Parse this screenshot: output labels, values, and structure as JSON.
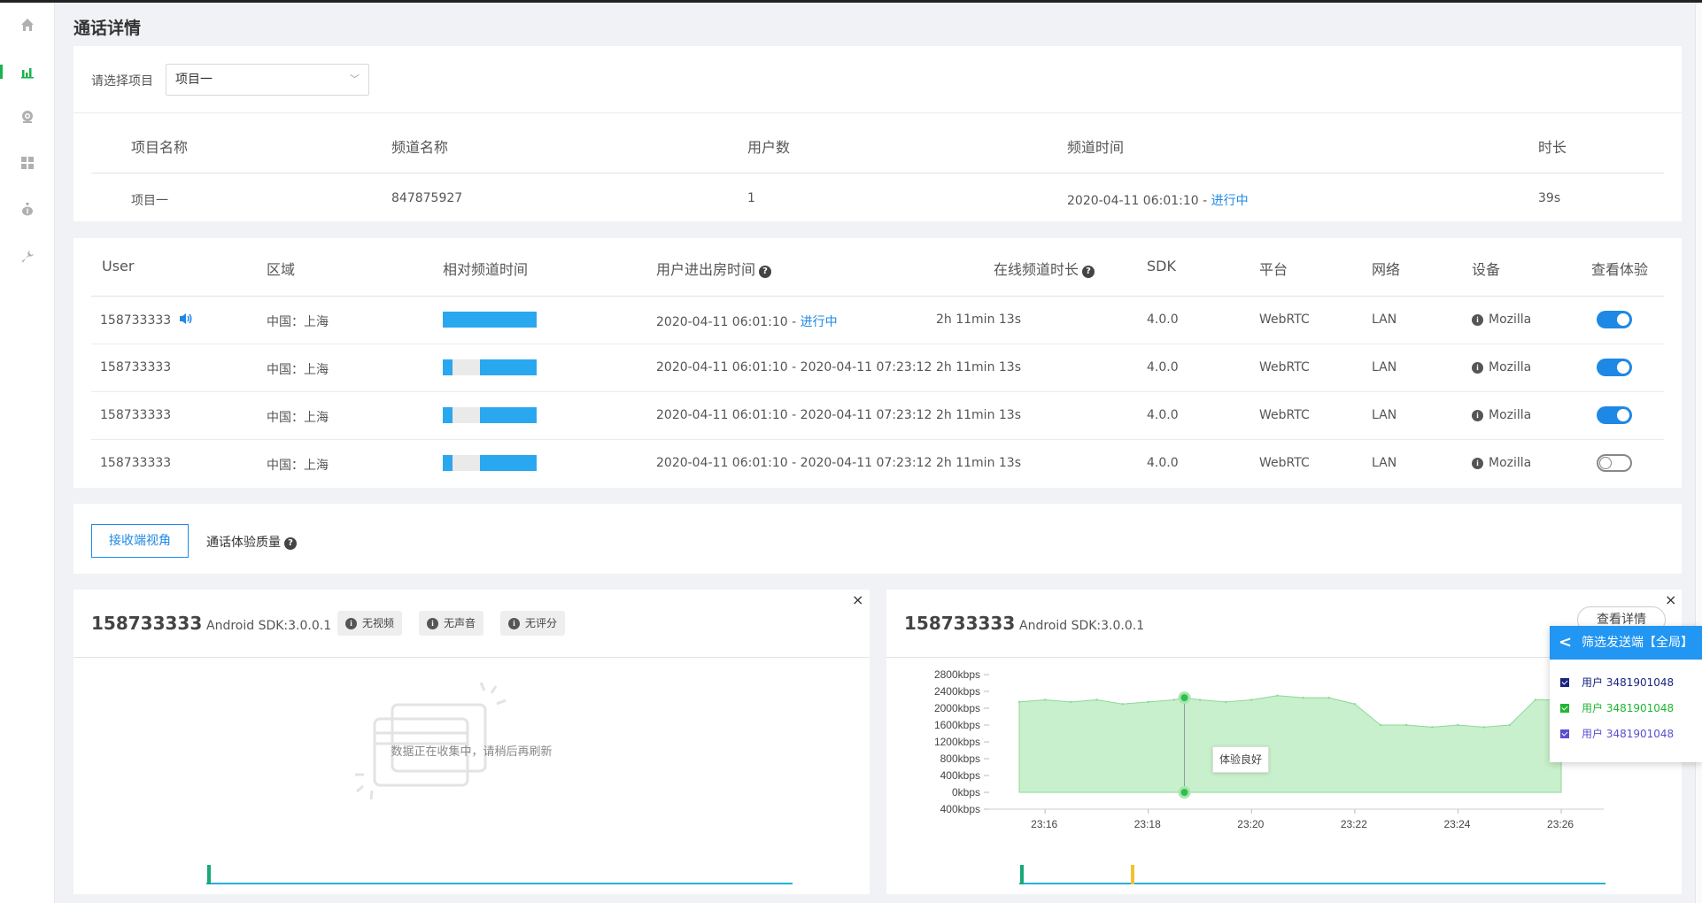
{
  "page": {
    "title": "通话详情"
  },
  "sidebar": {
    "items": [
      {
        "icon": "home-icon"
      },
      {
        "icon": "bar-chart-icon"
      },
      {
        "icon": "camera-icon"
      },
      {
        "icon": "grid-icon"
      },
      {
        "icon": "money-bag-icon"
      },
      {
        "icon": "wrench-icon"
      }
    ],
    "active_color": "#19b24b"
  },
  "project_select": {
    "label": "请选择项目",
    "value": "项目一"
  },
  "summary": {
    "headers": [
      "项目名称",
      "频道名称",
      "用户数",
      "频道时间",
      "时长"
    ],
    "row": {
      "project": "项目一",
      "channel": "847875927",
      "users": "1",
      "time": "2020-04-11 06:01:10",
      "time_sep": " - ",
      "status": "进行中",
      "duration": "39s"
    }
  },
  "users_table": {
    "headers": [
      "User",
      "区域",
      "相对频道时间",
      "用户进出房时间",
      "在线频道时长",
      "SDK",
      "平台",
      "网络",
      "设备",
      "查看体验"
    ],
    "rows": [
      {
        "user": "158733333",
        "region": "中国：上海",
        "bar": [
          [
            0,
            1
          ]
        ],
        "in": "2020-04-11 06:01:10",
        "sep": " - ",
        "out": "",
        "status": "进行中",
        "online": "2h 11min 13s",
        "sdk": "4.0.0",
        "platform": "WebRTC",
        "network": "LAN",
        "device": "Mozilla",
        "toggle": true,
        "speaking": true
      },
      {
        "user": "158733333",
        "region": "中国：上海",
        "bar": [
          [
            0,
            0.1
          ],
          [
            0.4,
            1
          ]
        ],
        "in": "2020-04-11 06:01:10",
        "sep": " - ",
        "out": "2020-04-11 07:23:12",
        "status": "",
        "online": "2h 11min 13s",
        "sdk": "4.0.0",
        "platform": "WebRTC",
        "network": "LAN",
        "device": "Mozilla",
        "toggle": true,
        "speaking": false
      },
      {
        "user": "158733333",
        "region": "中国：上海",
        "bar": [
          [
            0,
            0.1
          ],
          [
            0.4,
            1
          ]
        ],
        "in": "2020-04-11 06:01:10",
        "sep": " - ",
        "out": "2020-04-11 07:23:12",
        "status": "",
        "online": "2h 11min 13s",
        "sdk": "4.0.0",
        "platform": "WebRTC",
        "network": "LAN",
        "device": "Mozilla",
        "toggle": true,
        "speaking": false
      },
      {
        "user": "158733333",
        "region": "中国：上海",
        "bar": [
          [
            0,
            0.1
          ],
          [
            0.4,
            1
          ]
        ],
        "in": "2020-04-11 06:01:10",
        "sep": " - ",
        "out": "2020-04-11 07:23:12",
        "status": "",
        "online": "2h 11min 13s",
        "sdk": "4.0.0",
        "platform": "WebRTC",
        "network": "LAN",
        "device": "Mozilla",
        "toggle": false,
        "speaking": false
      }
    ]
  },
  "tabs": {
    "active": "接收端视角",
    "other": "通话体验质量"
  },
  "panel_left": {
    "uid": "158733333",
    "sdk": "Android SDK:3.0.0.1",
    "badges": [
      "无视频",
      "无声音",
      "无评分"
    ],
    "empty_text": "数据正在收集中，请稍后再刷新",
    "close": "×"
  },
  "panel_right": {
    "uid": "158733333",
    "sdk": "Android SDK:3.0.0.1",
    "detail_button": "查看详情",
    "tooltip": "体验良好",
    "close": "×",
    "chart_data": {
      "type": "area",
      "y_ticks": [
        "2800kbps",
        "2400kbps",
        "2000kbps",
        "1600kbps",
        "1200kbps",
        "800kbps",
        "400kbps",
        "0kbps",
        "400kbps"
      ],
      "x_ticks": [
        "23:16",
        "23:18",
        "23:20",
        "23:22",
        "23:24",
        "23:26"
      ],
      "ylim": [
        -400,
        2800
      ],
      "x": [
        "23:15.5",
        "23:16",
        "23:16.5",
        "23:17",
        "23:17.5",
        "23:18",
        "23:18.5",
        "23:18.7",
        "23:19",
        "23:19.5",
        "23:20",
        "23:20.5",
        "23:21",
        "23:21.5",
        "23:22",
        "23:22.5",
        "23:23",
        "23:23.5",
        "23:24",
        "23:24.5",
        "23:25",
        "23:25.5",
        "23:26"
      ],
      "series": [
        {
          "values": [
            2150,
            2200,
            2150,
            2200,
            2100,
            2150,
            2200,
            2250,
            2200,
            2150,
            2200,
            2300,
            2250,
            2250,
            2100,
            1600,
            1600,
            1550,
            1600,
            1550,
            1600,
            2200,
            2200
          ]
        }
      ],
      "color": "#c8f0cc",
      "line_color": "#8fd79b"
    }
  },
  "filter_panel": {
    "title": "筛选发送端【全局】",
    "items": [
      {
        "label": "用户 3481901048",
        "color": "#1a237e"
      },
      {
        "label": "用户 3481901048",
        "color": "#1fb534"
      },
      {
        "label": "用户 3481901048",
        "color": "#5a4fcf"
      }
    ]
  },
  "colors": {
    "accent": "#1e88e5",
    "bar": "#2aa8ef",
    "toggle_on": "#1e88e5"
  }
}
